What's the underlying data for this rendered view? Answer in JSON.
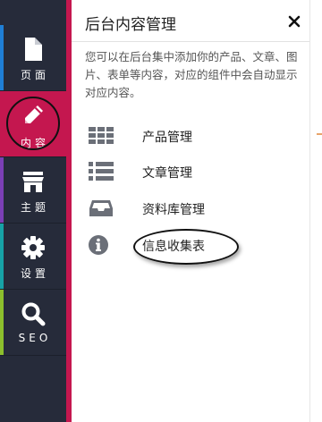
{
  "colors": {
    "sidebar_bg": "#262b3a",
    "active_bg": "#c4174f",
    "accent_pages": "#1f7fd6",
    "accent_content": "#c4174f",
    "accent_theme": "#7b3fb5",
    "accent_settings": "#17a2a6",
    "accent_seo": "#8cbf2d"
  },
  "sidebar": {
    "items": [
      {
        "label": "页面",
        "icon": "document-icon",
        "accent": "#1f7fd6"
      },
      {
        "label": "内容",
        "icon": "pencil-icon",
        "accent": "#c4174f",
        "active": true
      },
      {
        "label": "主题",
        "icon": "storefront-icon",
        "accent": "#7b3fb5"
      },
      {
        "label": "设置",
        "icon": "gear-icon",
        "accent": "#17a2a6"
      },
      {
        "label": "SEO",
        "icon": "search-icon",
        "accent": "#8cbf2d"
      }
    ]
  },
  "panel": {
    "title": "后台内容管理",
    "close_icon": "close-icon",
    "description": "您可以在后台集中添加你的产品、文章、图片、表单等内容，对应的组件中会自动显示对应内容。",
    "items": [
      {
        "label": "产品管理",
        "icon": "grid-icon"
      },
      {
        "label": "文章管理",
        "icon": "list-icon"
      },
      {
        "label": "资料库管理",
        "icon": "inbox-tray-icon"
      },
      {
        "label": "信息收集表",
        "icon": "info-circle-icon"
      }
    ]
  }
}
